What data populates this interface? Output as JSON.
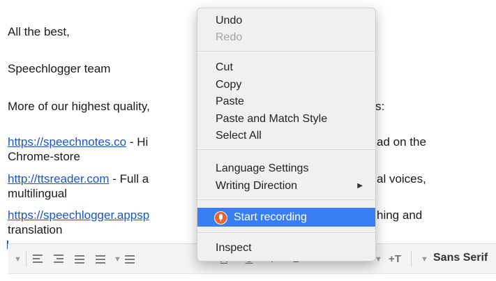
{
  "email": {
    "closing": "All the best,",
    "signature": "Speechlogger team",
    "more_left": "More of our highest quality,",
    "more_right": "s:",
    "link1": "https://speechnotes.co",
    "link1_mid": " - Hi",
    "link1_right": "ad on the",
    "link1_line2": "Chrome-store",
    "link2": "http://ttsreader.com",
    "link2_mid": " - Full a",
    "link2_right": "al voices,",
    "link2_line2": "multilingual",
    "link3": "https://speechlogger.appsp",
    "link3_right": "hing and",
    "link3_line2": "translation"
  },
  "toolbar": {
    "font_name": "Sans Serif",
    "underline_label": "U",
    "italic_label": "I",
    "bold_label": "B",
    "font_color_label": "A",
    "text_size_label": "+T"
  },
  "context_menu": {
    "undo": "Undo",
    "redo": "Redo",
    "cut": "Cut",
    "copy": "Copy",
    "paste": "Paste",
    "paste_match": "Paste and Match Style",
    "select_all": "Select All",
    "language_settings": "Language Settings",
    "writing_direction": "Writing Direction",
    "start_recording": "Start recording",
    "inspect": "Inspect"
  },
  "colors": {
    "link": "#1a55c4",
    "highlight": "#3a7ef3",
    "record_icon": "#f0612f"
  },
  "icons": [
    "chevron-down-icon",
    "align-left-icon",
    "align-right-icon",
    "numbered-list-icon",
    "bullet-list-icon",
    "align-justify-icon",
    "font-color-icon",
    "underline-icon",
    "italic-icon",
    "bold-icon",
    "text-size-icon",
    "microphone-icon",
    "submenu-arrow-icon"
  ]
}
